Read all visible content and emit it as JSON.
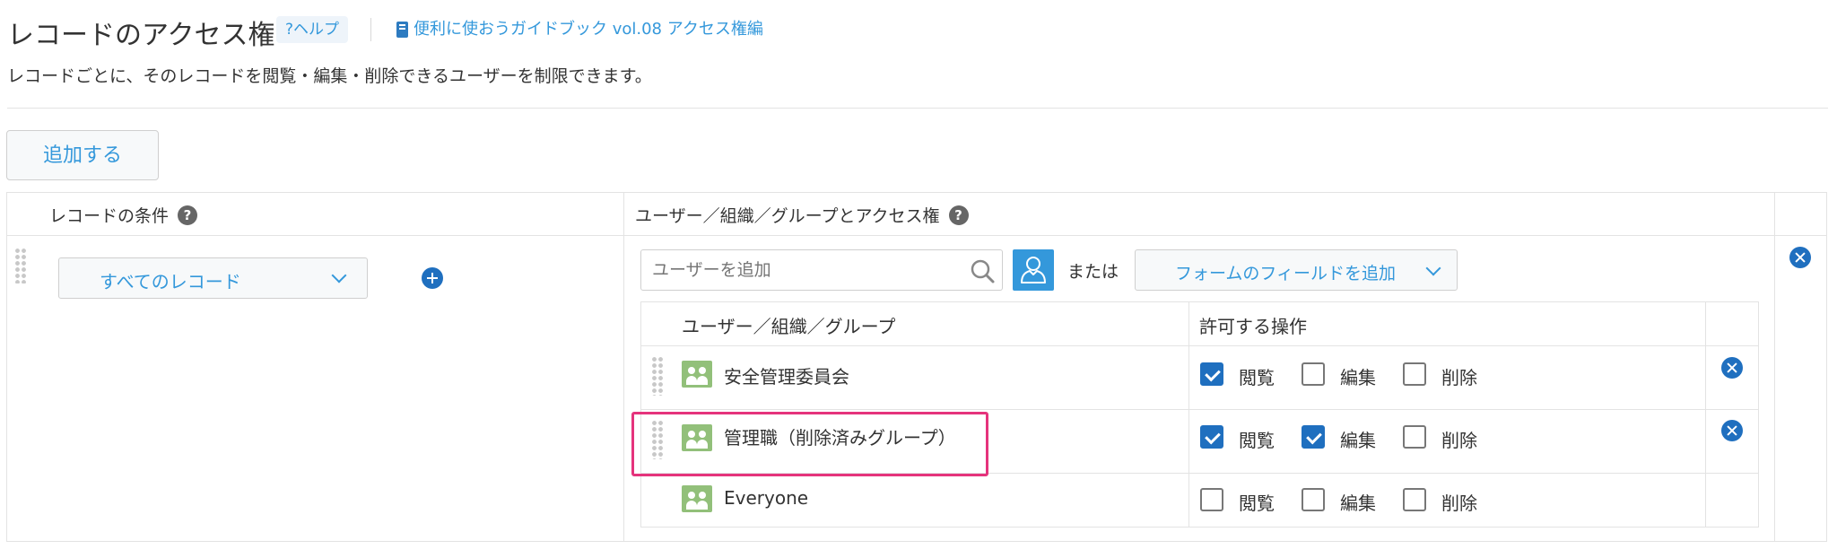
{
  "header": {
    "title": "レコードのアクセス権",
    "help_label": "?ヘルプ",
    "guide_label": "便利に使おうガイドブック vol.08 アクセス権編",
    "description": "レコードごとに、そのレコードを閲覧・編集・削除できるユーザーを制限できます。"
  },
  "toolbar": {
    "add_label": "追加する"
  },
  "table": {
    "col_condition": "レコードの条件",
    "col_access": "ユーザー／組織／グループとアクセス権",
    "condition_select": "すべてのレコード",
    "user_search_placeholder": "ユーザーを追加",
    "or_label": "または",
    "form_field_button": "フォームのフィールドを追加",
    "inner_headers": {
      "users": "ユーザー／組織／グループ",
      "actions": "許可する操作"
    },
    "permission_labels": {
      "view": "閲覧",
      "edit": "編集",
      "delete": "削除"
    },
    "entries": [
      {
        "name": "安全管理委員会",
        "view": true,
        "edit": false,
        "delete": false
      },
      {
        "name": "管理職（削除済みグループ）",
        "view": true,
        "edit": true,
        "delete": false,
        "highlighted": true
      },
      {
        "name": "Everyone",
        "view": false,
        "edit": false,
        "delete": false
      }
    ]
  },
  "colors": {
    "accent": "#3498db",
    "checkbox_on": "#1f6fbf",
    "group_icon": "#92c07a",
    "highlight": "#e5337c"
  }
}
